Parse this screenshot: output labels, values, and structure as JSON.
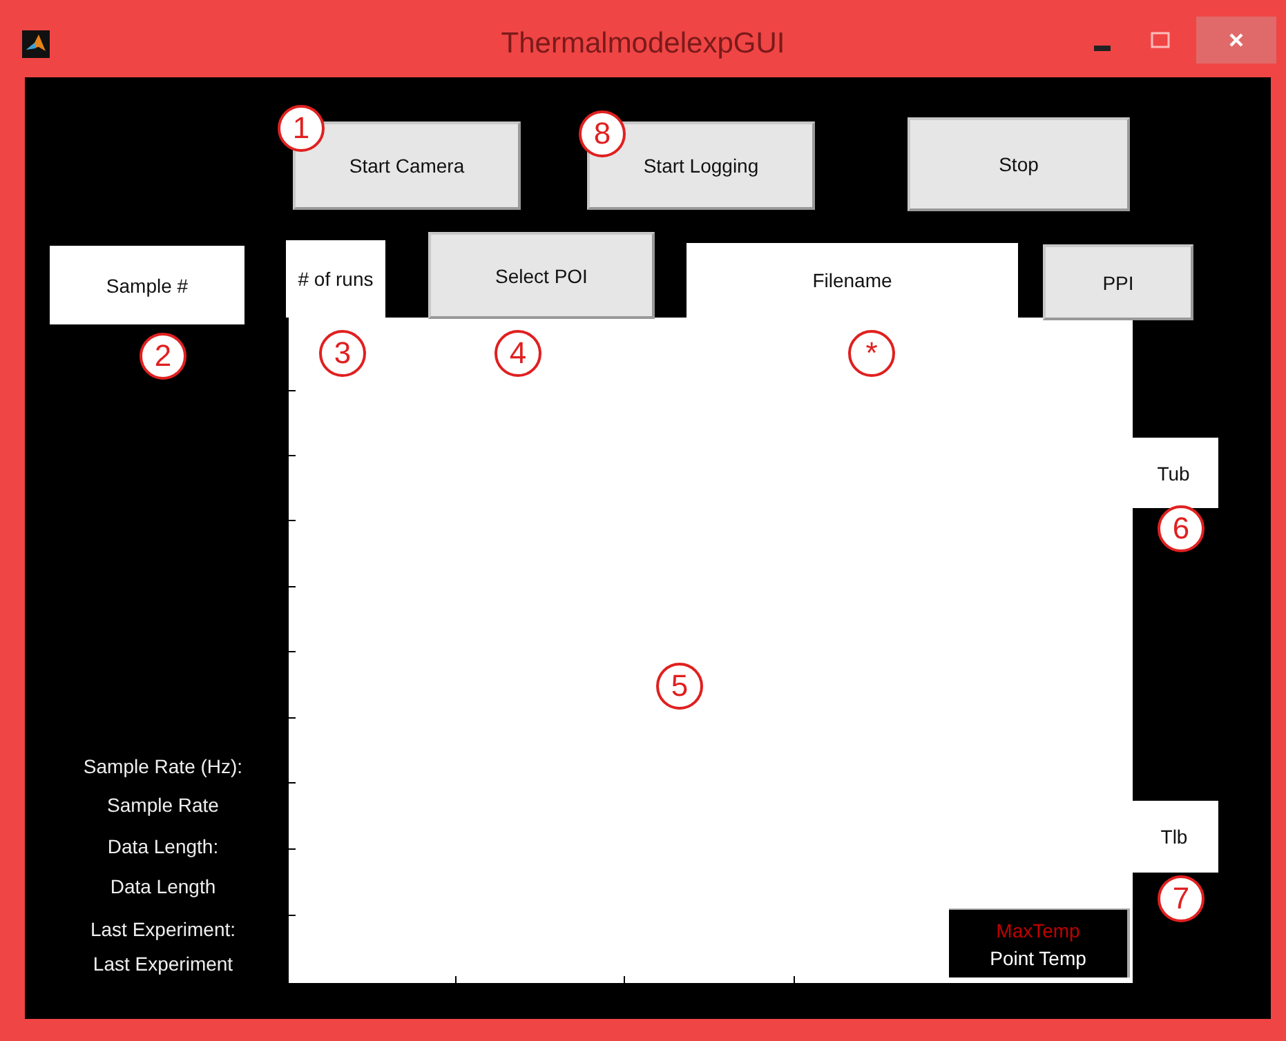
{
  "window": {
    "title": "ThermalmodelexpGUI"
  },
  "buttons": [
    {
      "label": "Start Camera"
    },
    {
      "label": "Start Logging"
    },
    {
      "label": "Stop"
    },
    {
      "label": "Select POI"
    },
    {
      "label": "PPI"
    }
  ],
  "fields": [
    {
      "value": "Sample #"
    },
    {
      "value": "# of runs"
    },
    {
      "value": "Filename"
    },
    {
      "value": "Tub"
    },
    {
      "value": "Tlb"
    }
  ],
  "info_labels": [
    "Sample Rate (Hz):",
    "Sample Rate",
    "Data Length:",
    "Data Length",
    "Last Experiment:",
    "Last Experiment"
  ],
  "legend": [
    {
      "label": "MaxTemp",
      "color": "#c00000"
    },
    {
      "label": "Point Temp",
      "color": "#ffffff"
    }
  ],
  "annotations": [
    "1",
    "8",
    "2",
    "3",
    "4",
    "*",
    "6",
    "5",
    "7"
  ]
}
